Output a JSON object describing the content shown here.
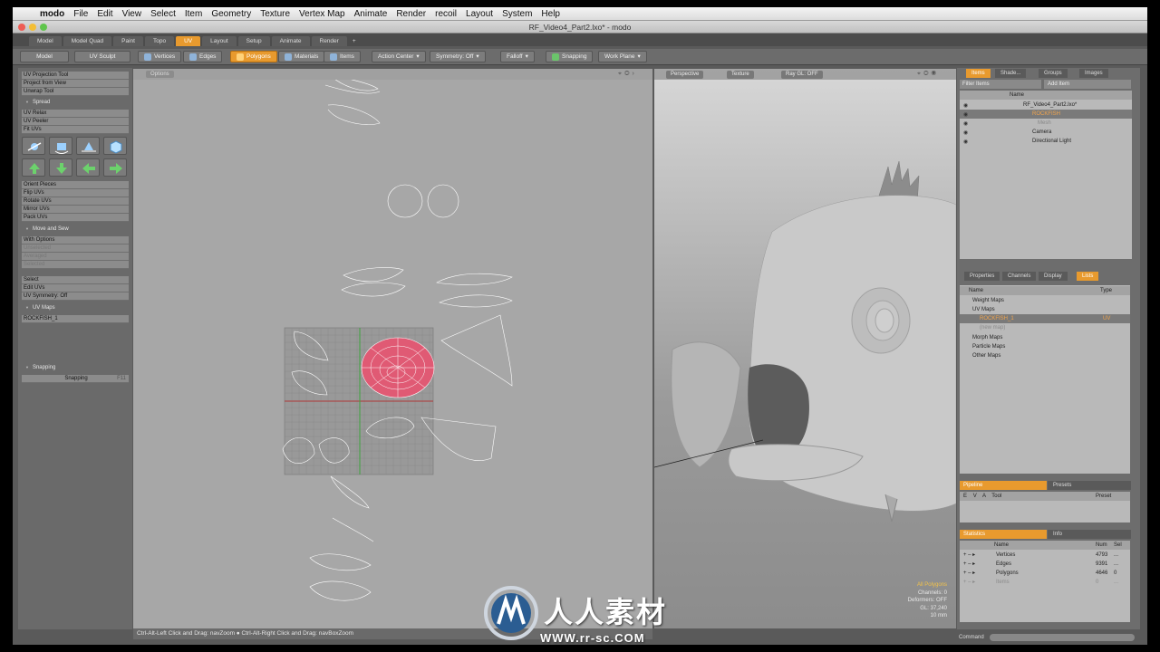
{
  "menubar": {
    "app_name": "modo",
    "items": [
      "File",
      "Edit",
      "View",
      "Select",
      "Item",
      "Geometry",
      "Texture",
      "Vertex Map",
      "Animate",
      "Render",
      "recoil",
      "Layout",
      "System",
      "Help"
    ]
  },
  "window": {
    "title": "RF_Video4_Part2.lxo* - modo"
  },
  "layout_tabs": [
    "Model",
    "Model Quad",
    "Paint",
    "Topo",
    "UV",
    "Layout",
    "Setup",
    "Animate",
    "Render"
  ],
  "layout_tabs_active": "UV",
  "toolbar": {
    "left_tabs": [
      "Model",
      "UV Sculpt"
    ],
    "modes": [
      "Vertices",
      "Edges",
      "Polygons",
      "Materials",
      "Items"
    ],
    "active_mode": "Polygons",
    "action_center": "Action Center",
    "symmetry": "Symmetry: Off",
    "falloff": "Falloff",
    "snapping": "Snapping",
    "work_plane": "Work Plane"
  },
  "left_panel": {
    "tools_top": [
      "UV Projection Tool",
      "Project from View",
      "Unwrap Tool"
    ],
    "spread_header": "Spread",
    "tools_mid": [
      "UV Relax",
      "UV Peeler",
      "Fit UVs"
    ],
    "tools_orient": [
      "Orient Pieces",
      "Flip UVs",
      "Rotate UVs",
      "Mirror UVs",
      "Pack UVs"
    ],
    "move_sew_header": "Move and Sew",
    "move_sew_items": [
      "With Options",
      "Unselected",
      "Averaged",
      "Selected"
    ],
    "select_items": [
      "Select",
      "Edit UVs",
      "UV Symmetry: Off"
    ],
    "uv_maps_header": "UV Maps",
    "uv_map_value": "ROCKFISH_1",
    "snapping_header": "Snapping",
    "snapping_btn": "Snapping",
    "snapping_key": "F11"
  },
  "uv_view": {
    "options_label": "Options"
  },
  "view3d": {
    "tabs": [
      "Perspective",
      "Texture",
      "Ray GL: OFF"
    ],
    "stats": [
      "All Polygons",
      "Channels: 0",
      "Deformers: OFF",
      "GL: 37,240",
      "10 mm"
    ]
  },
  "right_panel": {
    "top_tabs": [
      "Items",
      "Shade...",
      "Groups",
      "Images"
    ],
    "filter_label": "Filter Items",
    "add_item": "Add Item",
    "name_col": "Name",
    "items": [
      "RF_Video4_Part2.lxo*",
      "ROCKFISH",
      "Mesh",
      "Camera",
      "Directional Light"
    ],
    "mid_tabs": [
      "Properties",
      "Channels",
      "Display",
      "Lists"
    ],
    "lists_cols": [
      "Name",
      "Type"
    ],
    "lists_rows": [
      "Weight Maps",
      "UV Maps",
      "ROCKFISH_1",
      "(new map)",
      "Morph Maps",
      "Particle Maps",
      "Other Maps"
    ],
    "lists_type": "UV",
    "pipeline_tabs": [
      "Pipeline",
      "Presets"
    ],
    "pipeline_cols": [
      "E",
      "V",
      "A",
      "Tool",
      "Preset"
    ],
    "stats_tabs": [
      "Statistics",
      "Info"
    ],
    "stats_cols": [
      "Name",
      "Num",
      "Sel"
    ],
    "stats_rows": [
      {
        "name": "Vertices",
        "num": "4793",
        "sel": "..."
      },
      {
        "name": "Edges",
        "num": "9391",
        "sel": "..."
      },
      {
        "name": "Polygons",
        "num": "4646",
        "sel": "0"
      },
      {
        "name": "Items",
        "num": "0",
        "sel": "..."
      }
    ]
  },
  "statusbar": {
    "hint": "Ctrl-Alt-Left Click and Drag: navZoom ●  Ctrl-Alt-Right Click and Drag: navBoxZoom"
  },
  "command_label": "Command",
  "watermark": {
    "brand": "人人素材",
    "url": "WWW.rr-sc.COM"
  },
  "colors": {
    "accent": "#e89a2e",
    "uv_bg": "#a7a7a7",
    "selected_uv": "#e05a74"
  }
}
